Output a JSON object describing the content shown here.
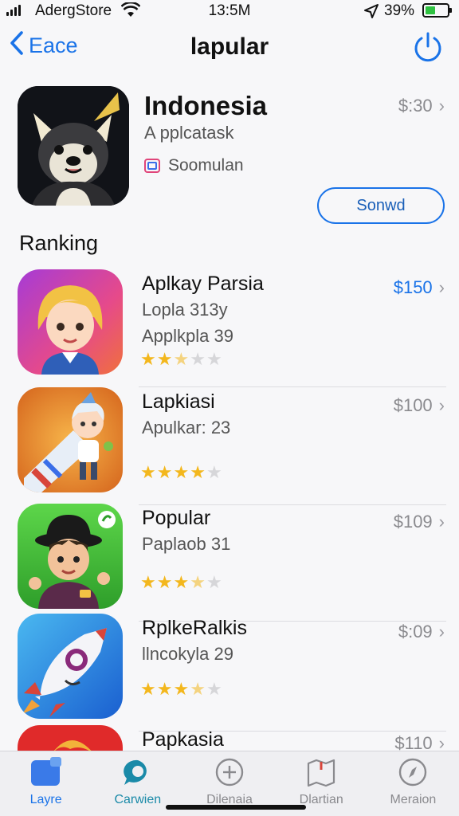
{
  "status_bar": {
    "carrier": "AdergStore",
    "time": "13:5M",
    "battery_percent": "39%"
  },
  "nav": {
    "back_label": "Eace",
    "title": "lapular"
  },
  "featured": {
    "name": "Indonesia",
    "subtitle": "A pplcatask",
    "developer": "Soomulan",
    "price": "$:30",
    "action_label": "Sonwd"
  },
  "ranking": {
    "title": "Ranking",
    "items": [
      {
        "name": "Aplkay Parsia",
        "line1": "Lopla 313y",
        "line2": "Applkpla 39",
        "price": "$150",
        "price_highlight": true,
        "rating": 2.5
      },
      {
        "name": "Lapkiasi",
        "line1": "Apulkar: 23",
        "line2": "",
        "price": "$100",
        "price_highlight": false,
        "rating": 4
      },
      {
        "name": "Popular",
        "line1": "Paplaob 31",
        "line2": "",
        "price": "$109",
        "price_highlight": false,
        "rating": 3.5
      },
      {
        "name": "RplkeRalkis",
        "line1": "llncokyla 29",
        "line2": "",
        "price": "$:09",
        "price_highlight": false,
        "rating": 3.5
      },
      {
        "name": "Papkasia",
        "line1": "",
        "line2": "",
        "price": "$110",
        "price_highlight": false,
        "rating": 0
      }
    ]
  },
  "tab_bar": {
    "tabs": [
      {
        "label": "Layre",
        "icon": "square-icon"
      },
      {
        "label": "Carwien",
        "icon": "chat-bubble-icon"
      },
      {
        "label": "Dilenaia",
        "icon": "plus-circle-icon"
      },
      {
        "label": "Dlartian",
        "icon": "map-icon"
      },
      {
        "label": "Meraion",
        "icon": "compass-icon"
      }
    ]
  },
  "colors": {
    "accent": "#1a73e8",
    "star": "#f3b71d",
    "secondary_text": "#8a8a8e"
  }
}
